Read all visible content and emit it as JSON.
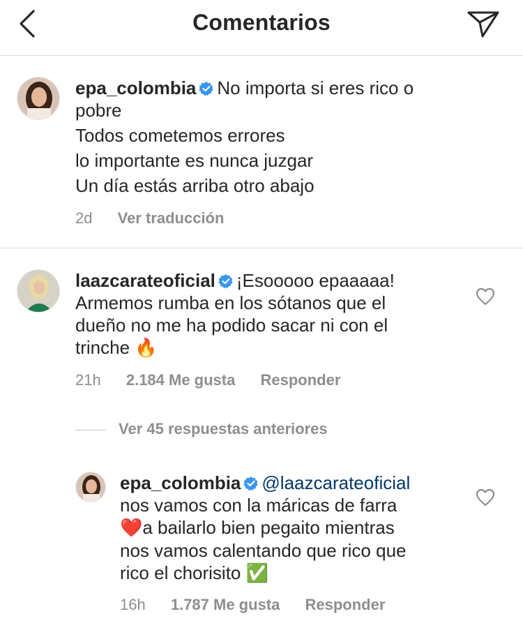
{
  "header": {
    "title": "Comentarios",
    "back_icon": "chevron-left-icon",
    "share_icon": "direct-send-icon"
  },
  "comments": [
    {
      "username": "epa_colombia",
      "verified": true,
      "lines": [
        "No importa si eres rico o",
        "pobre",
        "Todos cometemos errores",
        "lo importante es nunca juzgar",
        "Un día estás arriba otro abajo"
      ],
      "time": "2d",
      "action": "Ver traducción"
    },
    {
      "username": "laazcarateoficial",
      "verified": true,
      "lines": [
        "¡Esooooo epaaaaa!",
        "Armemos rumba en los sótanos que el",
        "dueño no me ha podido sacar ni con el",
        "trinche"
      ],
      "emoji": "🔥",
      "time": "21h",
      "likes": "2.184 Me gusta",
      "reply": "Responder"
    }
  ],
  "view_replies": "Ver 45 respuestas anteriores",
  "reply": {
    "username": "epa_colombia",
    "verified": true,
    "mention": "@laazcarateoficial",
    "line1": "nos vamos con la máricas de farra",
    "heart_emoji": "❤️",
    "line2": "a bailarlo bien pegaito mientras",
    "line3": "nos vamos calentando que rico que",
    "line4": "rico el chorisito",
    "check_emoji": "✅",
    "time": "16h",
    "likes": "1.787 Me gusta",
    "reply": "Responder"
  },
  "colors": {
    "text": "#262626",
    "secondary": "#8e8e8e",
    "mention": "#00376b",
    "verified": "#3897f0",
    "divider": "#dbdbdb"
  }
}
